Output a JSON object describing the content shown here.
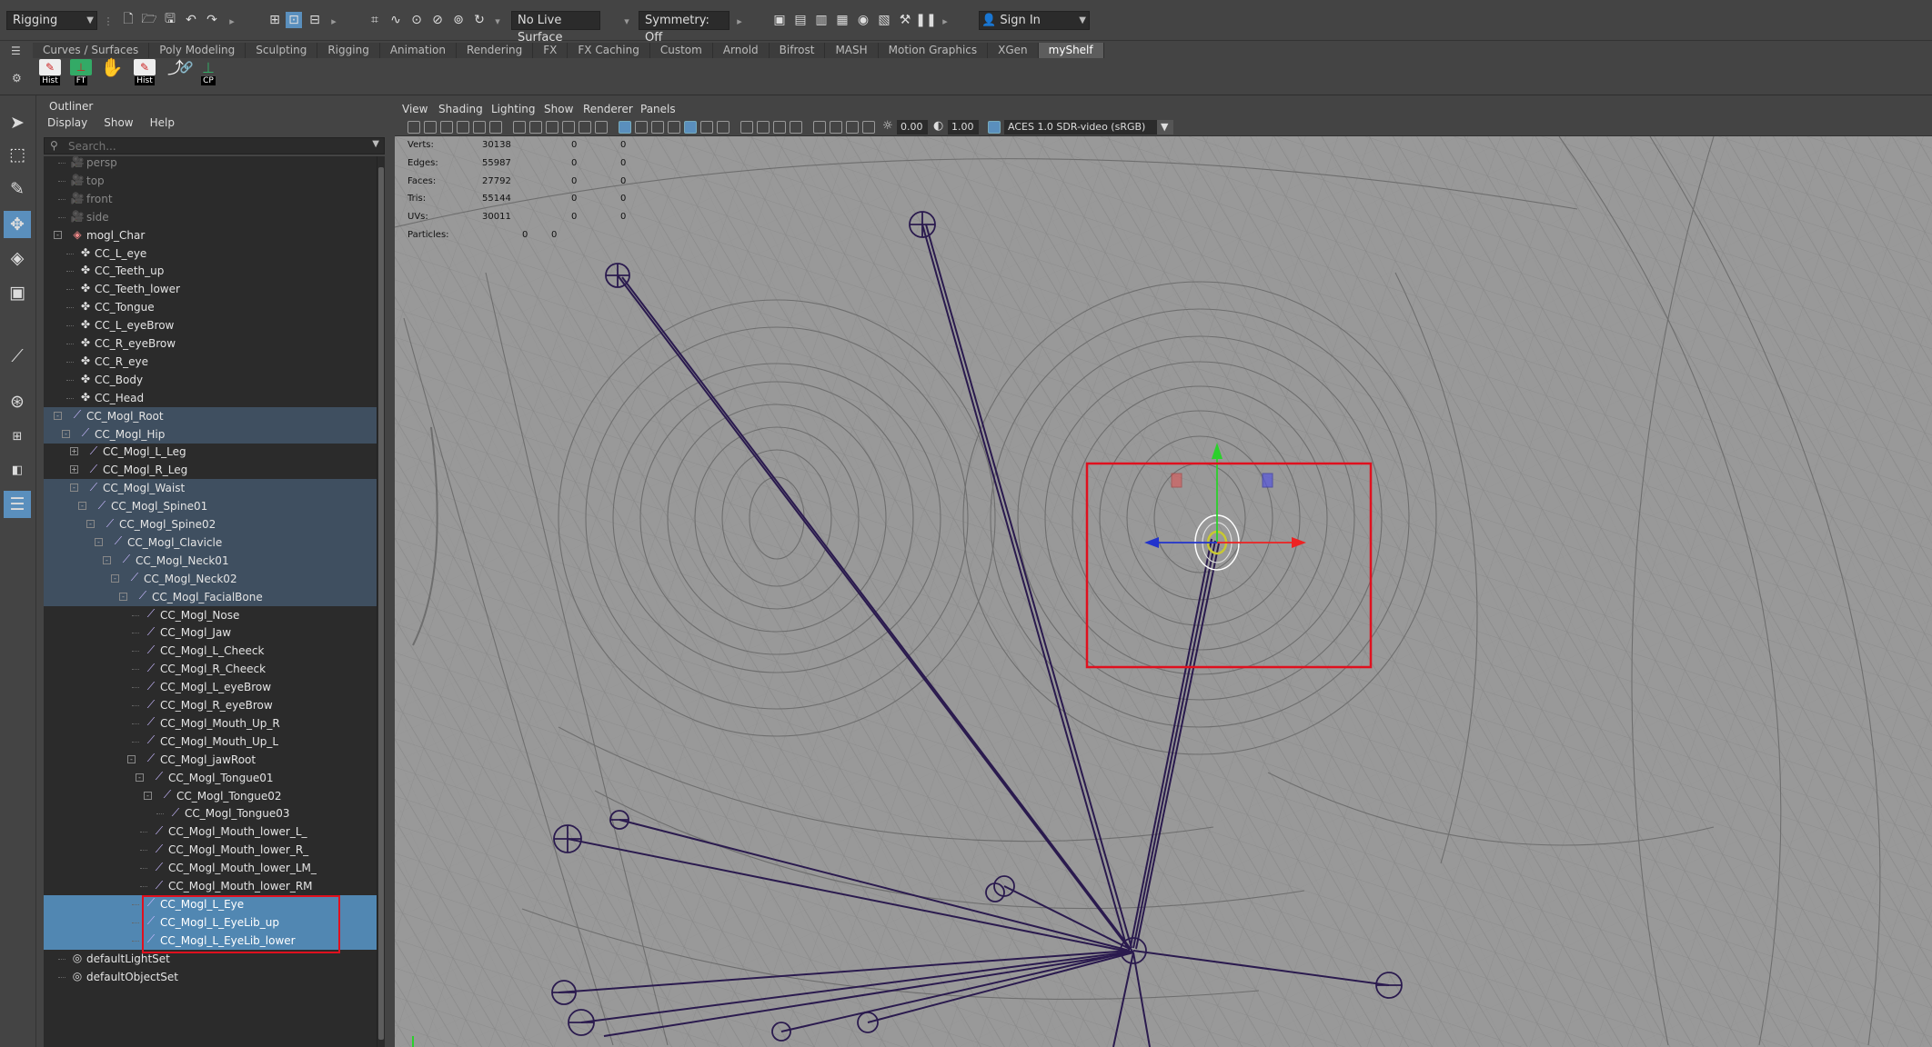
{
  "statusline": {
    "menuset": "Rigging",
    "live_surface": "No Live Surface",
    "symmetry": "Symmetry: Off",
    "sign_in": "Sign In"
  },
  "shelf": {
    "tabs": [
      "Curves / Surfaces",
      "Poly Modeling",
      "Sculpting",
      "Rigging",
      "Animation",
      "Rendering",
      "FX",
      "FX Caching",
      "Custom",
      "Arnold",
      "Bifrost",
      "MASH",
      "Motion Graphics",
      "XGen",
      "myShelf"
    ],
    "active_tab": "myShelf",
    "buttons": [
      {
        "caption": "Hist",
        "icon": "history-icon"
      },
      {
        "caption": "FT",
        "icon": "freeze-transform-icon"
      },
      {
        "caption": "",
        "icon": "hand-icon"
      },
      {
        "caption": "Hist",
        "icon": "history-icon"
      },
      {
        "caption": "",
        "icon": "joint-tool-icon"
      },
      {
        "caption": "CP",
        "icon": "center-pivot-icon"
      }
    ]
  },
  "outliner": {
    "title": "Outliner",
    "menu": [
      "Display",
      "Show",
      "Help"
    ],
    "search_placeholder": "Search...",
    "rows": [
      {
        "label": "persp",
        "indent": 0,
        "icon": "camera-icon",
        "dim": true
      },
      {
        "label": "top",
        "indent": 0,
        "icon": "camera-icon",
        "dim": true
      },
      {
        "label": "front",
        "indent": 0,
        "icon": "camera-icon",
        "dim": true
      },
      {
        "label": "side",
        "indent": 0,
        "icon": "camera-icon",
        "dim": true
      },
      {
        "label": "mogl_Char",
        "indent": 0,
        "icon": "group-icon",
        "exp": "-"
      },
      {
        "label": "CC_L_eye",
        "indent": 1,
        "icon": "curve-icon"
      },
      {
        "label": "CC_Teeth_up",
        "indent": 1,
        "icon": "curve-icon"
      },
      {
        "label": "CC_Teeth_lower",
        "indent": 1,
        "icon": "curve-icon"
      },
      {
        "label": "CC_Tongue",
        "indent": 1,
        "icon": "curve-icon"
      },
      {
        "label": "CC_L_eyeBrow",
        "indent": 1,
        "icon": "curve-icon"
      },
      {
        "label": "CC_R_eyeBrow",
        "indent": 1,
        "icon": "curve-icon"
      },
      {
        "label": "CC_R_eye",
        "indent": 1,
        "icon": "curve-icon"
      },
      {
        "label": "CC_Body",
        "indent": 1,
        "icon": "curve-icon"
      },
      {
        "label": "CC_Head",
        "indent": 1,
        "icon": "curve-icon"
      },
      {
        "label": "CC_Mogl_Root",
        "indent": 0,
        "icon": "joint-icon",
        "exp": "-",
        "hl": true
      },
      {
        "label": "CC_Mogl_Hip",
        "indent": 1,
        "icon": "joint-icon",
        "exp": "-",
        "hl": true
      },
      {
        "label": "CC_Mogl_L_Leg",
        "indent": 2,
        "icon": "joint-icon",
        "exp": "+"
      },
      {
        "label": "CC_Mogl_R_Leg",
        "indent": 2,
        "icon": "joint-icon",
        "exp": "+"
      },
      {
        "label": "CC_Mogl_Waist",
        "indent": 2,
        "icon": "joint-icon",
        "exp": "-",
        "hl": true
      },
      {
        "label": "CC_Mogl_Spine01",
        "indent": 3,
        "icon": "joint-icon",
        "exp": "-",
        "hl": true
      },
      {
        "label": "CC_Mogl_Spine02",
        "indent": 4,
        "icon": "joint-icon",
        "exp": "-",
        "hl": true
      },
      {
        "label": "CC_Mogl_Clavicle",
        "indent": 5,
        "icon": "joint-icon",
        "exp": "-",
        "hl": true
      },
      {
        "label": "CC_Mogl_Neck01",
        "indent": 6,
        "icon": "joint-icon",
        "exp": "-",
        "hl": true
      },
      {
        "label": "CC_Mogl_Neck02",
        "indent": 7,
        "icon": "joint-icon",
        "exp": "-",
        "hl": true
      },
      {
        "label": "CC_Mogl_FacialBone",
        "indent": 8,
        "icon": "joint-icon",
        "exp": "-",
        "hl": true
      },
      {
        "label": "CC_Mogl_Nose",
        "indent": 9,
        "icon": "joint-icon"
      },
      {
        "label": "CC_Mogl_Jaw",
        "indent": 9,
        "icon": "joint-icon"
      },
      {
        "label": "CC_Mogl_L_Cheeck",
        "indent": 9,
        "icon": "joint-icon"
      },
      {
        "label": "CC_Mogl_R_Cheeck",
        "indent": 9,
        "icon": "joint-icon"
      },
      {
        "label": "CC_Mogl_L_eyeBrow",
        "indent": 9,
        "icon": "joint-icon"
      },
      {
        "label": "CC_Mogl_R_eyeBrow",
        "indent": 9,
        "icon": "joint-icon"
      },
      {
        "label": "CC_Mogl_Mouth_Up_R",
        "indent": 9,
        "icon": "joint-icon"
      },
      {
        "label": "CC_Mogl_Mouth_Up_L",
        "indent": 9,
        "icon": "joint-icon"
      },
      {
        "label": "CC_Mogl_jawRoot",
        "indent": 9,
        "icon": "joint-icon",
        "exp": "-"
      },
      {
        "label": "CC_Mogl_Tongue01",
        "indent": 10,
        "icon": "joint-icon",
        "exp": "-"
      },
      {
        "label": "CC_Mogl_Tongue02",
        "indent": 11,
        "icon": "joint-icon",
        "exp": "-"
      },
      {
        "label": "CC_Mogl_Tongue03",
        "indent": 12,
        "icon": "joint-icon"
      },
      {
        "label": "CC_Mogl_Mouth_lower_L_",
        "indent": 10,
        "icon": "joint-icon"
      },
      {
        "label": "CC_Mogl_Mouth_lower_R_",
        "indent": 10,
        "icon": "joint-icon"
      },
      {
        "label": "CC_Mogl_Mouth_lower_LM_",
        "indent": 10,
        "icon": "joint-icon"
      },
      {
        "label": "CC_Mogl_Mouth_lower_RM",
        "indent": 10,
        "icon": "joint-icon"
      },
      {
        "label": "CC_Mogl_L_Eye",
        "indent": 9,
        "icon": "joint-icon",
        "sel": true
      },
      {
        "label": "CC_Mogl_L_EyeLib_up",
        "indent": 9,
        "icon": "joint-icon",
        "sel": true
      },
      {
        "label": "CC_Mogl_L_EyeLib_lower",
        "indent": 9,
        "icon": "joint-icon",
        "sel": true
      },
      {
        "label": "defaultLightSet",
        "indent": 0,
        "icon": "set-icon"
      },
      {
        "label": "defaultObjectSet",
        "indent": 0,
        "icon": "set-icon"
      }
    ]
  },
  "viewport": {
    "menu": [
      "View",
      "Shading",
      "Lighting",
      "Show",
      "Renderer",
      "Panels"
    ],
    "exposure": "0.00",
    "gamma": "1.00",
    "color_space": "ACES 1.0 SDR-video (sRGB)",
    "hud": [
      {
        "label": "Verts:",
        "a": "30138",
        "b": "0",
        "c": "0"
      },
      {
        "label": "Edges:",
        "a": "55987",
        "b": "0",
        "c": "0"
      },
      {
        "label": "Faces:",
        "a": "27792",
        "b": "0",
        "c": "0"
      },
      {
        "label": "Tris:",
        "a": "55144",
        "b": "0",
        "c": "0"
      },
      {
        "label": "UVs:",
        "a": "30011",
        "b": "0",
        "c": "0"
      },
      {
        "label": "Particles:",
        "a": "0",
        "b": "0",
        "c": ""
      }
    ]
  },
  "colors": {
    "selection": "#5187b2",
    "highlight": "#3f4f60",
    "annotation_red": "#e0101e",
    "joint_purple": "#2a1a4e",
    "wire_grey": "#6e6e6e"
  }
}
